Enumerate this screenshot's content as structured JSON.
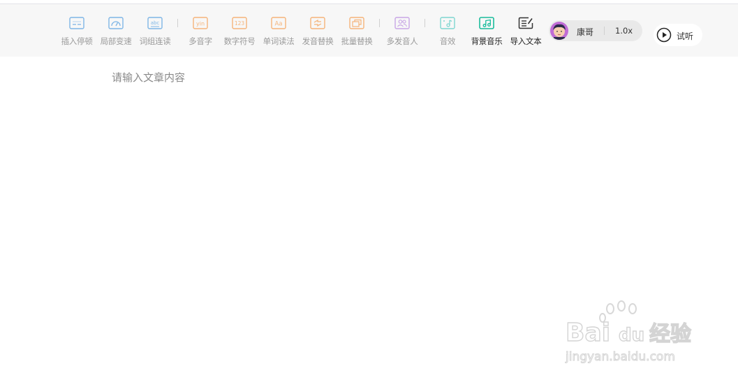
{
  "toolbar": {
    "tools": [
      {
        "label": "插入停顿",
        "icon": "insert-pause-icon"
      },
      {
        "label": "局部变速",
        "icon": "speed-gauge-icon"
      },
      {
        "label": "词组连读",
        "icon": "abc-icon"
      },
      {
        "label": "多音字",
        "icon": "yin-icon"
      },
      {
        "label": "数字符号",
        "icon": "number-123-icon"
      },
      {
        "label": "单词读法",
        "icon": "aa-icon"
      },
      {
        "label": "发音替换",
        "icon": "pronounce-replace-icon"
      },
      {
        "label": "批量替换",
        "icon": "batch-replace-icon"
      },
      {
        "label": "多发音人",
        "icon": "multi-speaker-icon"
      },
      {
        "label": "音效",
        "icon": "sound-effect-icon"
      },
      {
        "label": "背景音乐",
        "icon": "background-music-icon"
      },
      {
        "label": "导入文本",
        "icon": "import-text-icon"
      }
    ],
    "icon_texts": {
      "abc": "abc",
      "yin": "yin",
      "num": "123",
      "aa": "Aa"
    },
    "colors": {
      "blue": "#7fb6e6",
      "orange": "#f5b47a",
      "purple": "#c8a6e6",
      "teal": "#7fd6d0",
      "green": "#1abc9c",
      "dark": "#333333"
    }
  },
  "voice": {
    "name": "康哥",
    "speed": "1.0x"
  },
  "listen": {
    "label": "试听"
  },
  "editor": {
    "placeholder": "请输入文章内容"
  },
  "watermark": {
    "brand": "Bai",
    "brand2": "du",
    "cn": "经验",
    "url": "jingyan.baidu.com"
  }
}
